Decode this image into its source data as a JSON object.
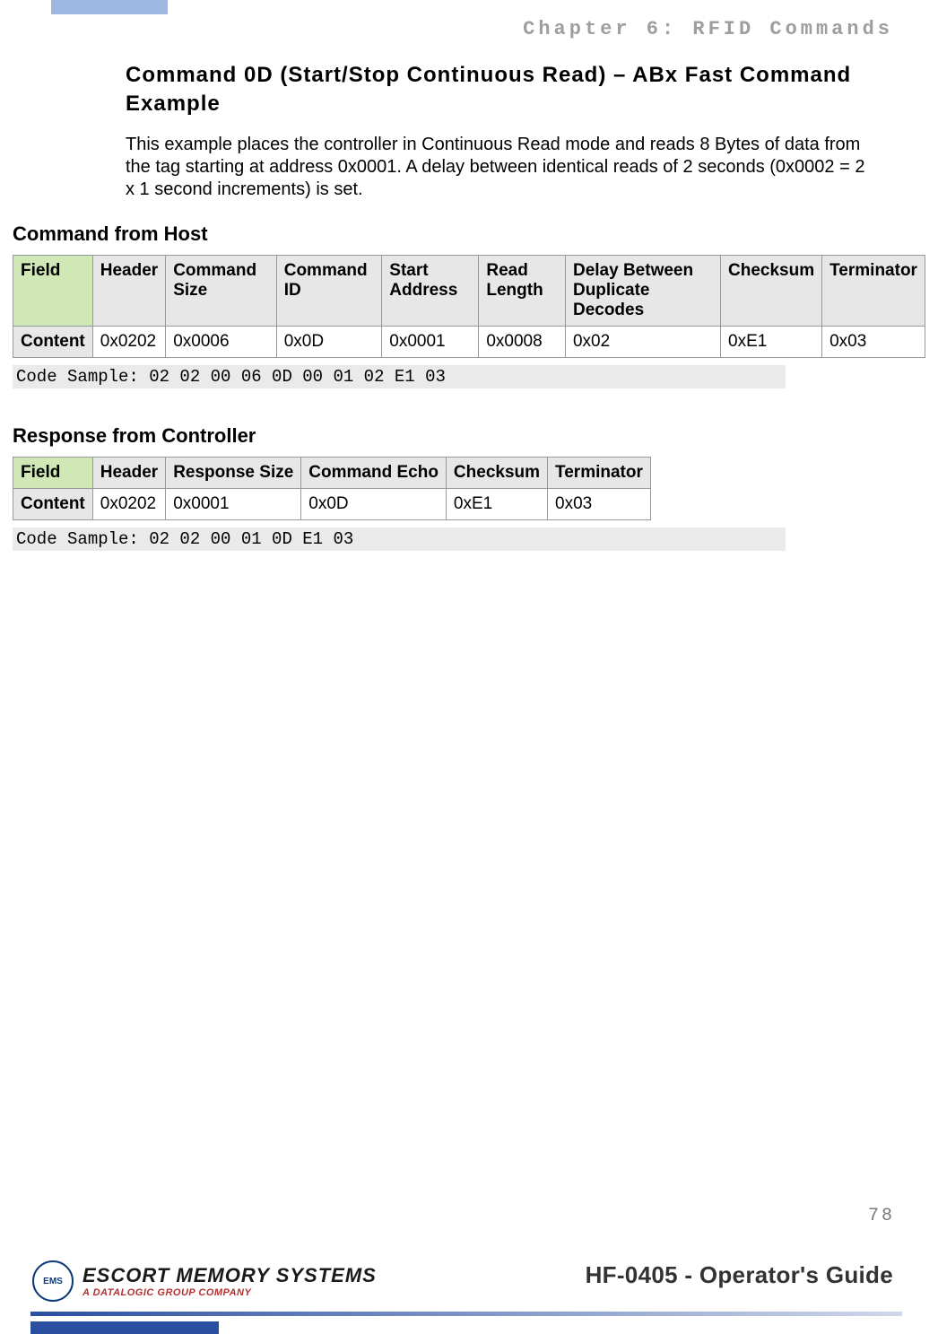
{
  "chapter_header": "Chapter 6: RFID Commands",
  "section_title": "Command 0D (Start/Stop Continuous Read) – ABx Fast Command Example",
  "intro_paragraph": "This example places the controller in Continuous Read mode and reads 8 Bytes of data from the tag starting at address 0x0001. A delay between identical reads of 2 seconds (0x0002 = 2 x 1 second increments) is set.",
  "host": {
    "heading": "Command from Host",
    "row_labels": {
      "field": "Field",
      "content": "Content"
    },
    "columns": [
      "Header",
      "Command Size",
      "Command ID",
      "Start Address",
      "Read Length",
      "Delay Between Duplicate Decodes",
      "Checksum",
      "Terminator"
    ],
    "values": [
      "0x0202",
      "0x0006",
      "0x0D",
      "0x0001",
      "0x0008",
      "0x02",
      "0xE1",
      "0x03"
    ],
    "code_sample": "Code Sample: 02 02 00 06 0D 00 01 02 E1 03"
  },
  "controller": {
    "heading": "Response from Controller",
    "row_labels": {
      "field": "Field",
      "content": "Content"
    },
    "columns": [
      "Header",
      "Response Size",
      "Command Echo",
      "Checksum",
      "Terminator"
    ],
    "values": [
      "0x0202",
      "0x0001",
      "0x0D",
      "0xE1",
      "0x03"
    ],
    "code_sample": "Code Sample: 02 02 00 01 0D E1 03"
  },
  "page_number": "78",
  "footer": {
    "logo_badge": "EMS",
    "logo_line1": "ESCORT MEMORY SYSTEMS",
    "logo_line2": "A DATALOGIC GROUP COMPANY",
    "guide_title": "HF-0405 - Operator's Guide"
  }
}
